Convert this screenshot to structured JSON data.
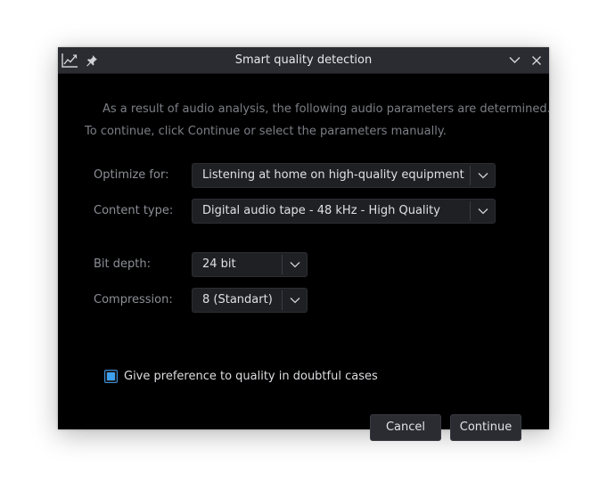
{
  "window": {
    "title": "Smart quality detection"
  },
  "info": {
    "line1": "As a result of audio analysis, the following audio parameters are determined.",
    "line2": "To continue, click Continue or select the parameters manually."
  },
  "fields": {
    "optimize_for": {
      "label": "Optimize for:",
      "value": "Listening at home on high-quality equipment"
    },
    "content_type": {
      "label": "Content type:",
      "value": "Digital audio tape - 48 kHz - High Quality"
    },
    "bit_depth": {
      "label": "Bit depth:",
      "value": "24 bit"
    },
    "compression": {
      "label": "Compression:",
      "value": "8 (Standart)"
    }
  },
  "preference": {
    "label": "Give preference to quality in doubtful cases",
    "checked": true
  },
  "buttons": {
    "cancel": "Cancel",
    "continue": "Continue"
  },
  "icons": {
    "app": "chart-line-icon",
    "pin": "pin-icon",
    "minimize": "chevron-down-icon",
    "close": "close-icon"
  },
  "colors": {
    "accent": "#3da0ee",
    "background": "#000000",
    "titlebar": "#2a2c31"
  }
}
